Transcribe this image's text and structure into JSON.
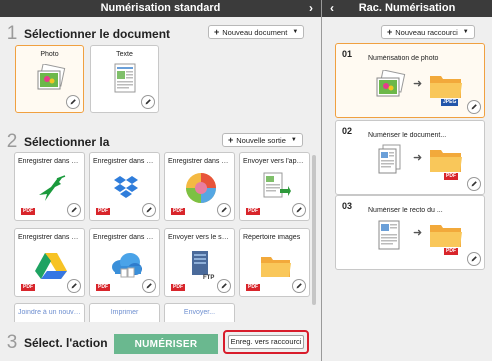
{
  "left": {
    "title": "Numérisation standard",
    "step1": {
      "num": "1",
      "label": "Sélectionner le document",
      "button": "Nouveau document"
    },
    "documents": [
      {
        "label": "Photo"
      },
      {
        "label": "Texte"
      }
    ],
    "step2": {
      "num": "2",
      "label": "Sélectionner la",
      "button": "Nouvelle sortie"
    },
    "outputs": [
      {
        "label": "Enregistrer dans S...",
        "icon": "hummingbird-icon",
        "badge": "PDF",
        "badge_color": "#d8252b"
      },
      {
        "label": "Enregistrer dans D...",
        "icon": "dropbox-icon",
        "badge": "PDF",
        "badge_color": "#d8252b"
      },
      {
        "label": "Enregistrer dans M...",
        "icon": "palette-icon",
        "badge": "PDF",
        "badge_color": "#d8252b"
      },
      {
        "label": "Envoyer vers l'appli...",
        "icon": "document-app-icon",
        "badge": "PDF",
        "badge_color": "#d8252b"
      },
      {
        "label": "Enregistrer dans G...",
        "icon": "drive-icon",
        "badge": "PDF",
        "badge_color": "#d8252b"
      },
      {
        "label": "Enregistrer dans O...",
        "icon": "cloud-icon",
        "badge": "PDF",
        "badge_color": "#d8252b"
      },
      {
        "label": "Envoyer vers le ser...",
        "icon": "ftp-server-icon",
        "badge": "PDF",
        "badge_color": "#d8252b",
        "sub": "FTP"
      },
      {
        "label": "Répertoire images",
        "icon": "folder-icon",
        "badge": "PDF",
        "badge_color": "#d8252b"
      }
    ],
    "partial_row": [
      "Joindre à un nouvel...",
      "Imprimer",
      "Envoyer..."
    ],
    "step3": {
      "num": "3",
      "label": "Sélect. l'action",
      "scan_button": "NUMÉRISER",
      "save_button": "Enreg. vers raccourci"
    }
  },
  "right": {
    "title": "Rac. Numérisation",
    "button": "Nouveau raccourci",
    "shortcuts": [
      {
        "num": "01",
        "title": "Numérisation de photo",
        "badge": "JPEG",
        "badge_color": "#2255aa"
      },
      {
        "num": "02",
        "title": "Numériser le document...",
        "badge": "PDF",
        "badge_color": "#d8252b"
      },
      {
        "num": "03",
        "title": "Numériser le recto du ...",
        "badge": "PDF",
        "badge_color": "#d8252b"
      }
    ]
  }
}
